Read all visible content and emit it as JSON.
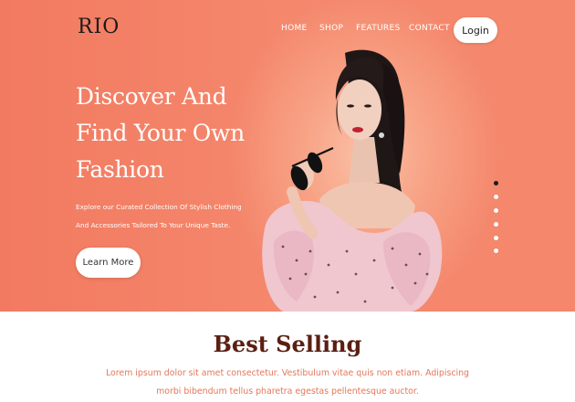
{
  "brand": {
    "logo_text": "RIO"
  },
  "nav": {
    "links": [
      "HOME",
      "SHOP",
      "FEATURES",
      "CONTACT"
    ],
    "login_label": "Login"
  },
  "hero": {
    "headline_lines": [
      "Discover And",
      "Find Your Own",
      "Fashion"
    ],
    "subtext_lines": [
      "Explore our Curated Collection Of Stylish Clothing",
      "And Accessories Tailored  To Your Unique Taste."
    ],
    "cta_label": "Learn More",
    "slider": {
      "count": 6,
      "active_index": 0
    }
  },
  "best_selling": {
    "title": "Best Selling",
    "description_lines": [
      "Lorem ipsum dolor sit amet consectetur. Vestibulum vitae quis non etiam. Adipiscing",
      "morbi bibendum tellus pharetra egestas pellentesque auctor."
    ]
  },
  "colors": {
    "hero_bg": "#f4876c",
    "title_brown": "#5a1f12",
    "desc_coral": "#e4775a"
  }
}
